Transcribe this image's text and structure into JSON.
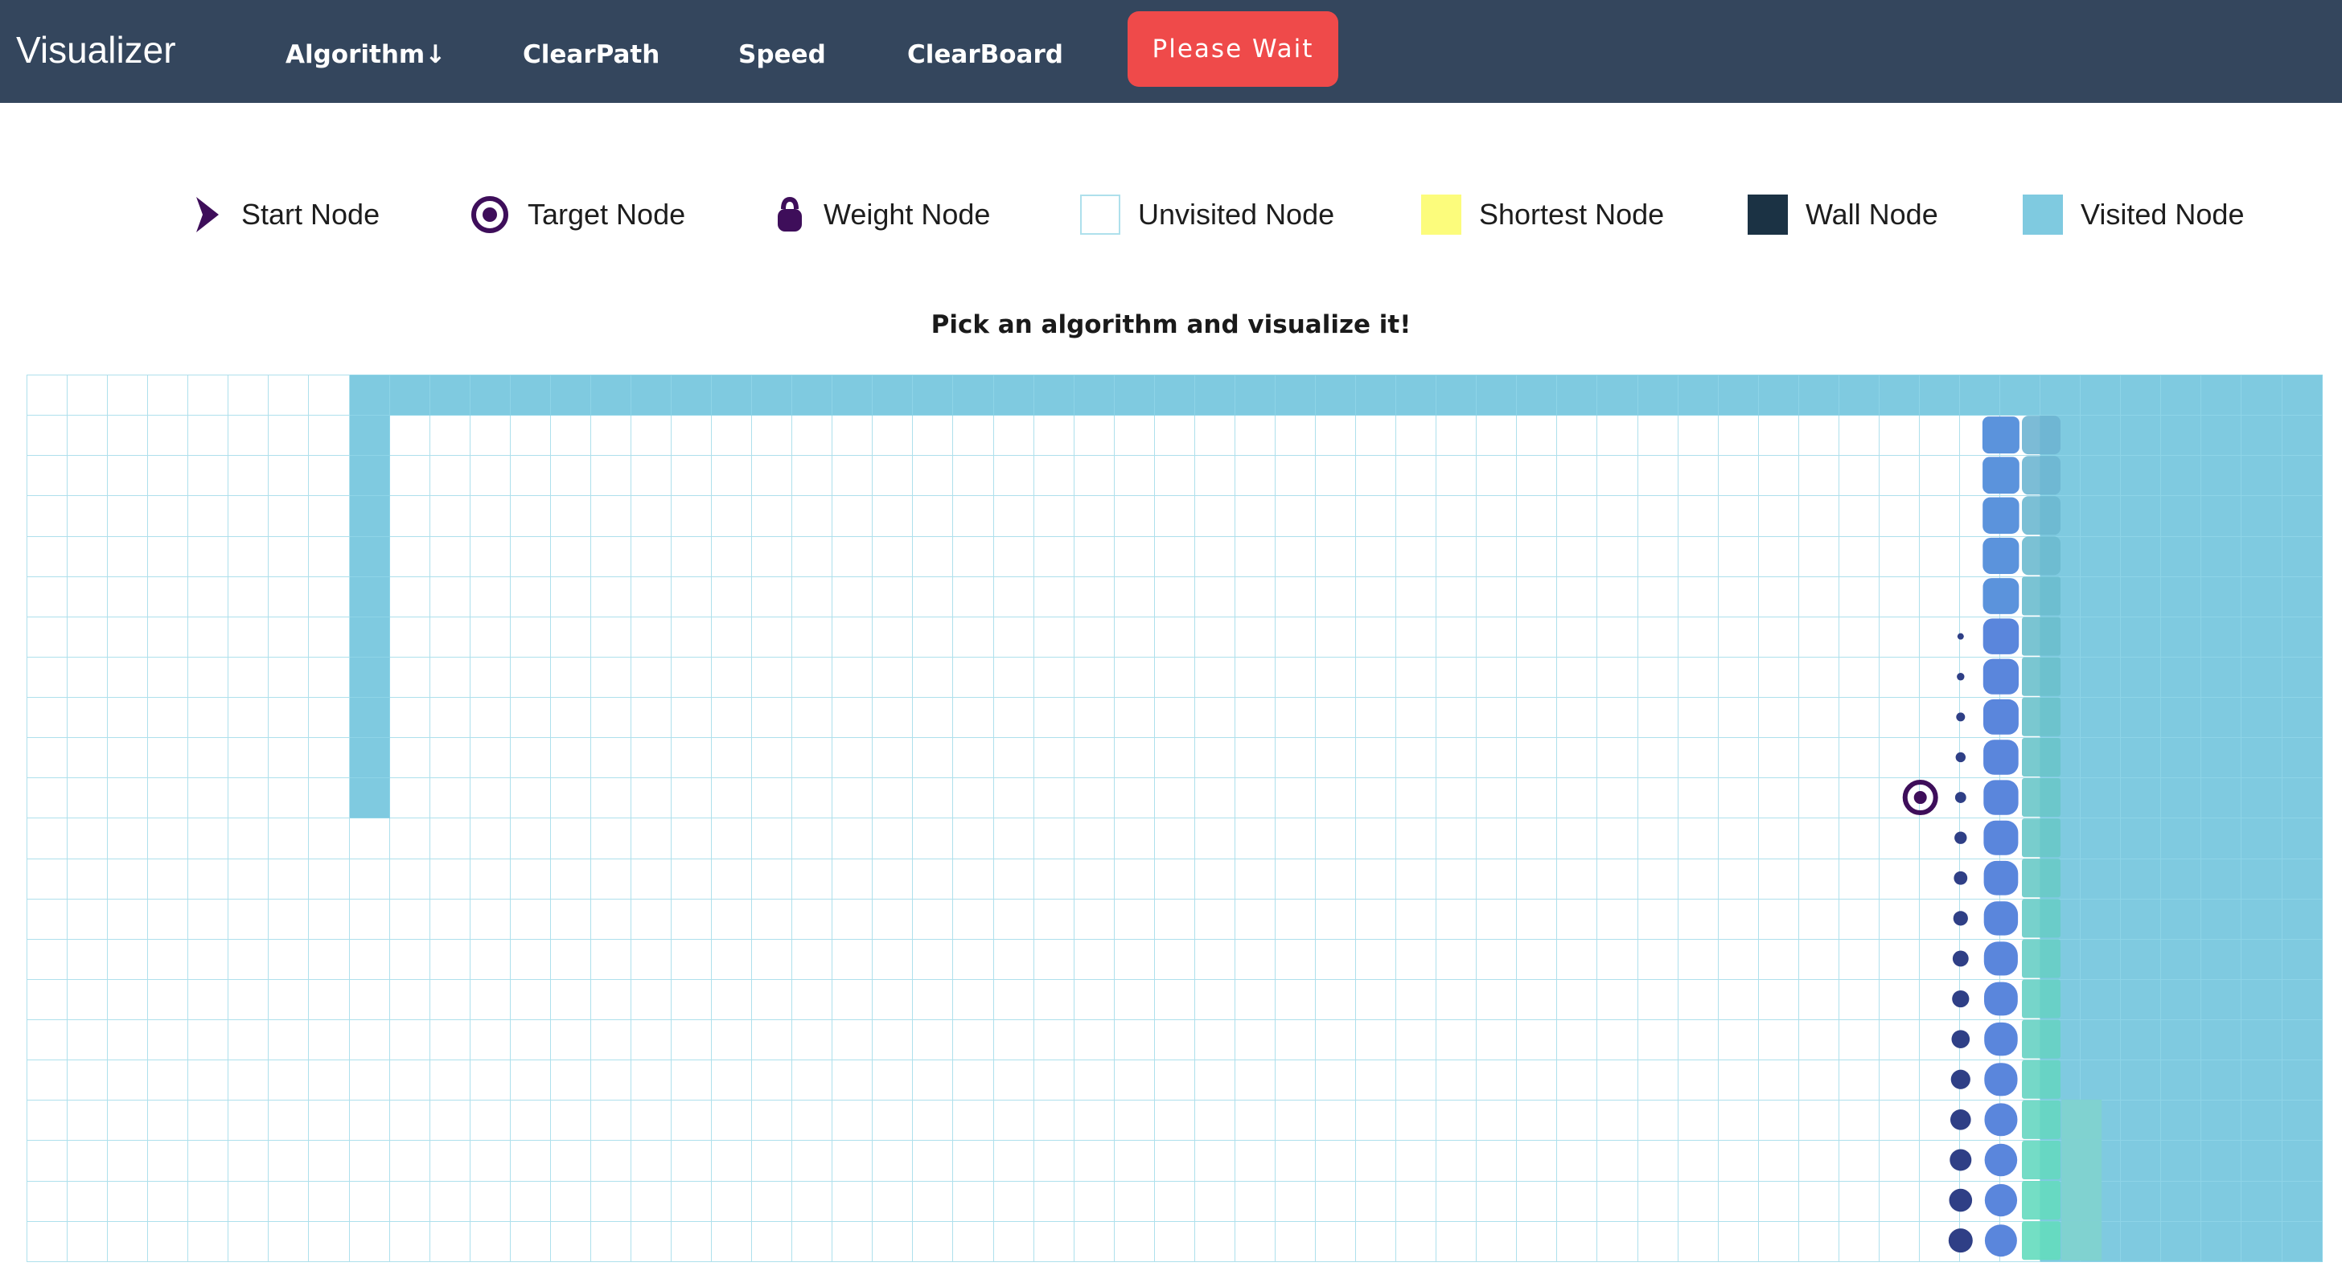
{
  "navbar": {
    "brand": "Visualizer",
    "items": [
      {
        "label": "Algorithm↓"
      },
      {
        "label": "ClearPath"
      },
      {
        "label": "Speed"
      },
      {
        "label": "ClearBoard"
      }
    ],
    "status_button": "Please Wait"
  },
  "legend": {
    "start": "Start Node",
    "target": "Target Node",
    "weight": "Weight Node",
    "unvisited": "Unvisited Node",
    "shortest": "Shortest Node",
    "wall": "Wall Node",
    "visited": "Visited Node"
  },
  "subtitle": "Pick an algorithm and visualize it!",
  "grid": {
    "rows": 22,
    "cols": 57
  },
  "colors": {
    "navbar": "#34465d",
    "status_button": "#ef4a4a",
    "visited": "#7fcae0",
    "shortest": "#fcfc7c",
    "wall": "#1b3244",
    "node_icon": "#3e0e5a",
    "grid_line": "#aee0ec"
  }
}
